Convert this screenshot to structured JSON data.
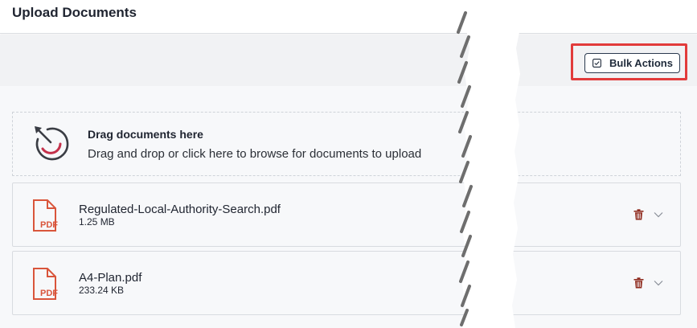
{
  "header": {
    "title": "Upload Documents"
  },
  "toolbar": {
    "bulk_actions_label": "Bulk Actions"
  },
  "dropzone": {
    "title": "Drag documents here",
    "subtitle": "Drag and drop or click here to browse for documents to upload"
  },
  "files": [
    {
      "name": "Regulated-Local-Authority-Search.pdf",
      "size": "1.25 MB",
      "icon": "pdf-icon",
      "icon_label": "PDF"
    },
    {
      "name": "A4-Plan.pdf",
      "size": "233.24 KB",
      "icon": "pdf-icon",
      "icon_label": "PDF"
    }
  ],
  "icons": {
    "bulk": "checkbox-icon",
    "dropzone": "upload-arrow-icon",
    "delete": "trash-icon",
    "expand": "chevron-down-icon"
  },
  "colors": {
    "accent_red": "#d9553b",
    "highlight_red": "#e23b3b",
    "trash_red": "#8f2b1e",
    "dark_navy": "#1f2a3a"
  }
}
